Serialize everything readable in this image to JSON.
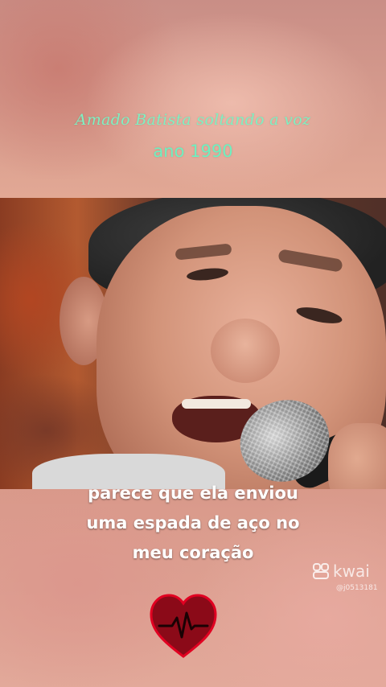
{
  "overlay": {
    "title_line_1": "Amado Batista soltando a voz",
    "title_line_2": "ano 1990"
  },
  "video": {
    "description_icon": "singer-with-microphone-photo"
  },
  "subtitle": {
    "lines": [
      "parece que ela enviou",
      "uma espada de aço no",
      "meu coração"
    ]
  },
  "watermark": {
    "brand": "kwai",
    "handle": "@j0513181"
  },
  "icons": {
    "heart": "heart-heartbeat-icon",
    "kwai_logo": "kwai-logo-icon"
  },
  "colors": {
    "title": "#7ff0c2",
    "heart_fill": "#8b0a18",
    "heart_outline": "#e10021"
  }
}
